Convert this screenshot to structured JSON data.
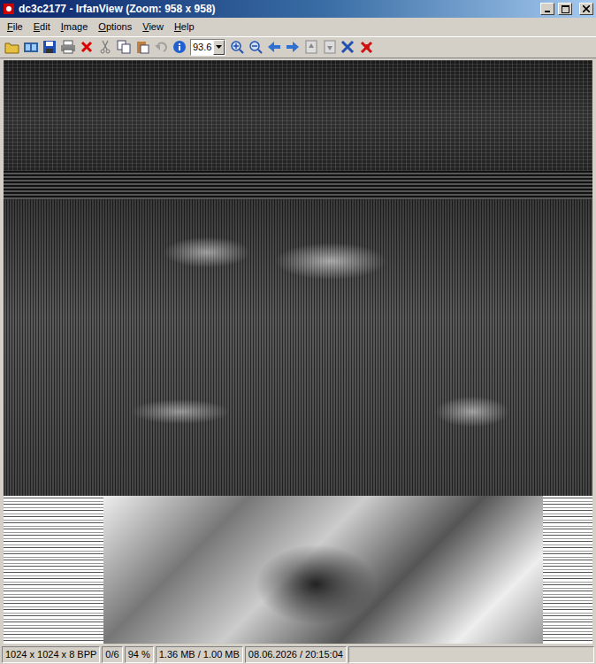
{
  "window": {
    "title": "dc3c2177 - IrfanView (Zoom: 958 x 958)"
  },
  "menu": [
    {
      "label": "File"
    },
    {
      "label": "Edit"
    },
    {
      "label": "Image"
    },
    {
      "label": "Options"
    },
    {
      "label": "View"
    },
    {
      "label": "Help"
    }
  ],
  "toolbar": {
    "zoom": "93.6"
  },
  "status_bar": [
    "1024 x 1024 x 8 BPP",
    "0/6",
    "94 %",
    "1.36 MB / 1.00 MB",
    "08.06.2026 / 20:15:04"
  ]
}
